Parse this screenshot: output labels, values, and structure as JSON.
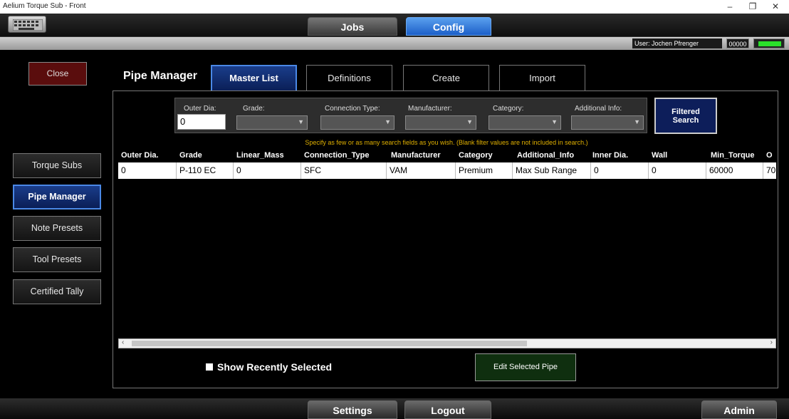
{
  "window": {
    "title": "Aelium Torque Sub - Front",
    "minimize": "–",
    "restore": "❐",
    "close": "✕"
  },
  "nav": {
    "keyboard_icon": "keyboard-icon",
    "jobs": "Jobs",
    "config": "Config"
  },
  "status": {
    "user": "User: Jochen Pfrenger",
    "code": "00000",
    "indicator_color": "#2ae02a"
  },
  "sidebar": {
    "close": "Close",
    "items": [
      {
        "label": "Torque Subs"
      },
      {
        "label": "Pipe Manager",
        "active": true
      },
      {
        "label": "Note Presets"
      },
      {
        "label": "Tool Presets"
      },
      {
        "label": "Certified Tally"
      }
    ]
  },
  "header": {
    "title": "Pipe Manager",
    "tabs": [
      {
        "label": "Master List",
        "active": true
      },
      {
        "label": "Definitions"
      },
      {
        "label": "Create"
      },
      {
        "label": "Import"
      }
    ]
  },
  "filters": {
    "outer_dia_label": "Outer Dia:",
    "outer_dia_value": "0",
    "grade_label": "Grade:",
    "connection_type_label": "Connection Type:",
    "manufacturer_label": "Manufacturer:",
    "category_label": "Category:",
    "additional_info_label": "Additional Info:",
    "search_button_line1": "Filtered",
    "search_button_line2": "Search",
    "hint": "Specify as few or as many search fields as you wish. (Blank filter values are not included in search.)"
  },
  "table": {
    "columns": [
      "Outer Dia.",
      "Grade",
      "Linear_Mass",
      "Connection_Type",
      "Manufacturer",
      "Category",
      "Additional_Info",
      "Inner Dia.",
      "Wall",
      "Min_Torque",
      "O"
    ],
    "rows": [
      [
        "0",
        "P-110 EC",
        "0",
        "SFC",
        "VAM",
        "Premium",
        "Max Sub Range",
        "0",
        "0",
        "60000",
        "70"
      ]
    ]
  },
  "footer_panel": {
    "show_recent": "Show Recently Selected",
    "edit_button": "Edit Selected Pipe"
  },
  "bottom": {
    "settings": "Settings",
    "logout": "Logout",
    "admin": "Admin"
  },
  "colors": {
    "accent_blue": "#1c5fc8",
    "close_red": "#5a0d0d",
    "edit_green": "#0f2f0f",
    "hint_yellow": "#e0b000"
  }
}
